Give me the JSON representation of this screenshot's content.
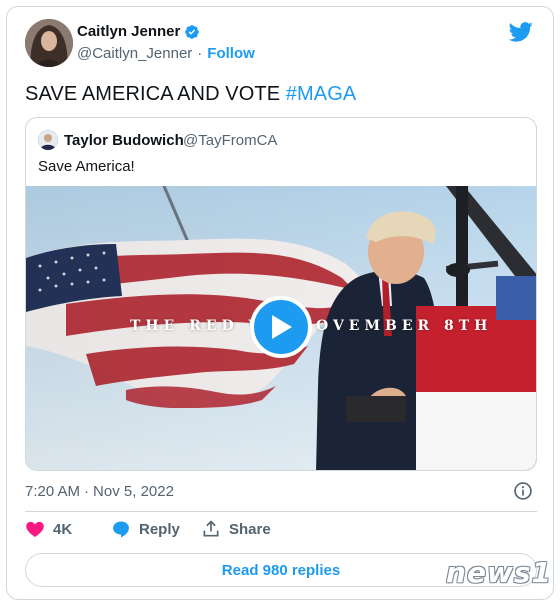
{
  "author": {
    "display_name": "Caitlyn Jenner",
    "handle": "@Caitlyn_Jenner",
    "follow_label": "Follow",
    "verified": true
  },
  "tweet": {
    "text": "SAVE AMERICA AND VOTE ",
    "hashtag": "#MAGA"
  },
  "quoted": {
    "display_name": "Taylor Budowich",
    "handle": "@TayFromCA",
    "text": "Save America!",
    "video_overlay_left": "THE RED WA",
    "video_overlay_right": "OVEMBER 8TH"
  },
  "meta": {
    "time": "7:20 AM",
    "separator": "·",
    "date": "Nov 5, 2022"
  },
  "actions": {
    "like_count": "4K",
    "reply_label": "Reply",
    "share_label": "Share",
    "read_replies_label": "Read 980 replies"
  },
  "watermark": "news1",
  "colors": {
    "brand": "#1d9bf0",
    "like": "#f91880",
    "text": "#0f1419",
    "muted": "#536471",
    "border": "#cfd9de"
  }
}
